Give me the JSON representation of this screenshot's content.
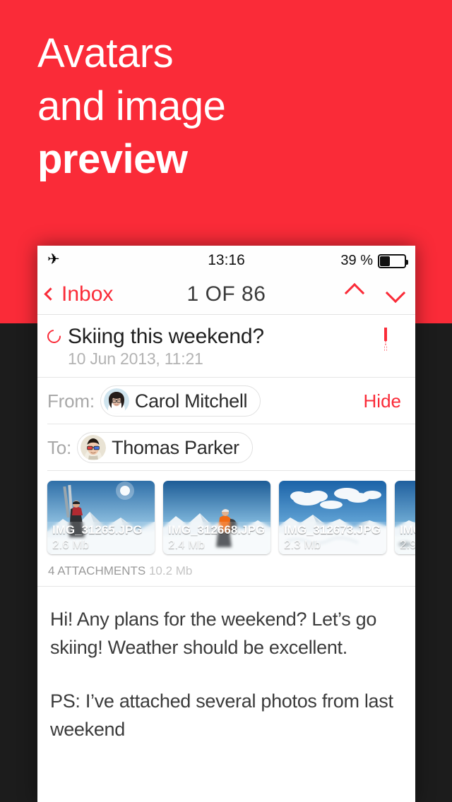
{
  "promo": {
    "line1": "Avatars",
    "line2": "and image",
    "line3": "preview",
    "bg_color": "#fa2b38",
    "dark_color": "#1c1c1c"
  },
  "statusbar": {
    "airplane_icon": "airplane-icon",
    "time": "13:16",
    "battery_percent": "39 %",
    "battery_level": 39
  },
  "navbar": {
    "back_label": "Inbox",
    "title": "1 OF 86",
    "prev_icon": "chevron-up-icon",
    "next_icon": "chevron-down-icon",
    "accent_color": "#fa2b38"
  },
  "message": {
    "unread_icon": "unread-circle-icon",
    "subject": "Skiing this weekend?",
    "date": "10 Jun 2013, 11:21",
    "flag_icon": "bookmark-icon",
    "from_label": "From:",
    "from_name": "Carol Mitchell",
    "hide_label": "Hide",
    "to_label": "To:",
    "to_name": "Thomas Parker",
    "body_paragraphs": [
      "Hi! Any plans for the weekend? Let’s go skiing! Weather should be excellent.",
      "PS: I’ve attached several photos from last weekend"
    ]
  },
  "attachments": {
    "count_label": "4 ATTACHMENTS",
    "total_size": "10.2 Mb",
    "items": [
      {
        "filename": "IMG_31265.JPG",
        "size": "2.6 Mb",
        "scene": "skier-summit"
      },
      {
        "filename": "IMG_312668.JPG",
        "size": "2.4 Mb",
        "scene": "laptop-summit"
      },
      {
        "filename": "IMG_312673.JPG",
        "size": "2.3 Mb",
        "scene": "clouds-peaks"
      },
      {
        "filename": "IMG",
        "size": "2.9",
        "scene": "swiss-flag"
      }
    ]
  }
}
